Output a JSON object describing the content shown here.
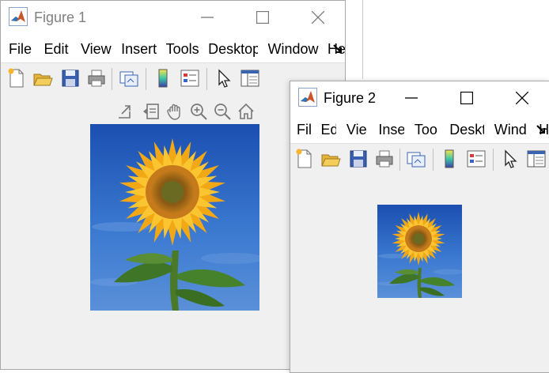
{
  "background_window": {
    "color": "#ffffff"
  },
  "figure1": {
    "title": "Figure 1",
    "state": "inactive",
    "menu": [
      "File",
      "Edit",
      "View",
      "Insert",
      "Tools",
      "Desktop",
      "Window",
      "Help"
    ],
    "toolbar_icons": [
      "new-figure-icon",
      "open-file-icon",
      "save-icon",
      "print-icon",
      "link-plot-icon",
      "insert-colorbar-icon",
      "insert-legend-icon",
      "edit-plot-arrow-icon",
      "property-inspector-icon"
    ],
    "axes_toolbar_icons": [
      "export-icon",
      "brush-icon",
      "pan-icon",
      "zoom-in-icon",
      "zoom-out-icon",
      "restore-view-icon"
    ],
    "image": "sunflower-photo"
  },
  "figure2": {
    "title": "Figure 2",
    "state": "active",
    "menu": [
      "File",
      "Edit",
      "View",
      "Insert",
      "Tools",
      "Desktop",
      "Window",
      "Help"
    ],
    "menu_visible": [
      "Fil",
      "Ed",
      "Vie",
      "Inse",
      "Too",
      "Deskt",
      "Wind",
      "Hel"
    ],
    "toolbar_icons": [
      "new-figure-icon",
      "open-file-icon",
      "save-icon",
      "print-icon",
      "link-plot-icon",
      "insert-colorbar-icon",
      "insert-legend-icon",
      "edit-plot-arrow-icon",
      "property-inspector-icon"
    ],
    "image": "sunflower-photo"
  },
  "colors": {
    "window_bg": "#f0f0f0",
    "titlebar_bg": "#ffffff",
    "sky_blue": "#2a64c8",
    "petal_yellow": "#f4b21c",
    "leaf_green": "#3c7a2a"
  }
}
